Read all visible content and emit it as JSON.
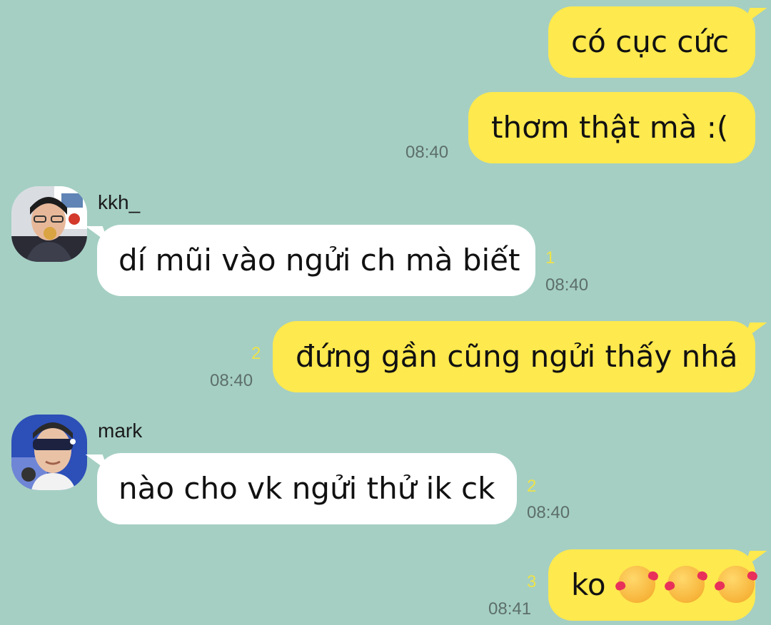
{
  "messages": [
    {
      "text": "có cục cức",
      "sender": "me"
    },
    {
      "text": "thơm thật mà :(",
      "sender": "me",
      "time": "08:40"
    },
    {
      "name": "kkh_",
      "text": "dí mũi vào ngửi ch mà biết",
      "sender": "them",
      "unread": "1",
      "time": "08:40"
    },
    {
      "text": "đứng gần cũng ngửi thấy nhá",
      "sender": "me",
      "unread": "2",
      "time": "08:40"
    },
    {
      "name": "mark",
      "text": "nào cho vk ngửi thử ik ck",
      "sender": "them",
      "unread": "2",
      "time": "08:40"
    },
    {
      "text": "ko",
      "sender": "me",
      "unread": "3",
      "time": "08:41",
      "emoji": "smiling-face-with-hearts ×3"
    }
  ],
  "colors": {
    "background": "#a5cfc3",
    "my_bubble": "#fee94e",
    "their_bubble": "#ffffff",
    "unread": "#ece24a"
  }
}
